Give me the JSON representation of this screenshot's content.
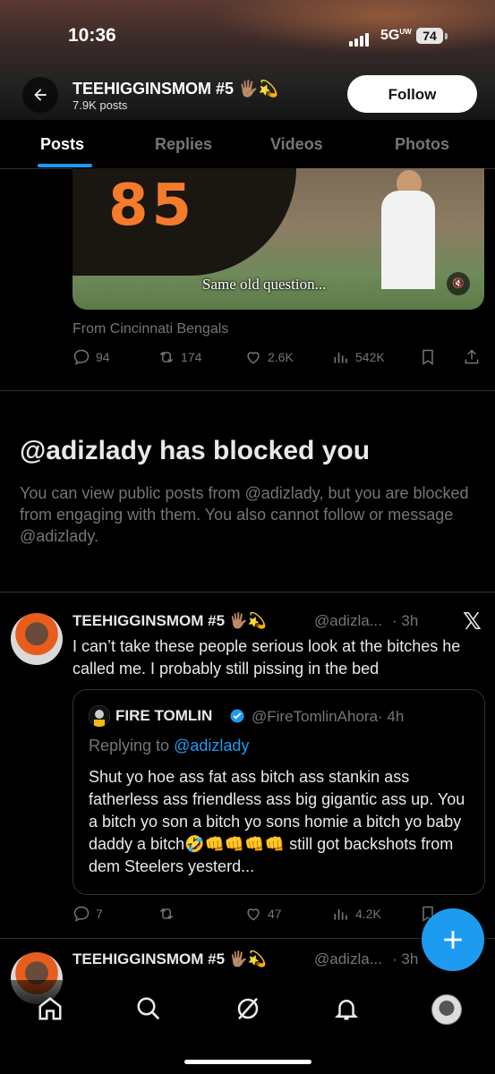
{
  "status_bar": {
    "time": "10:36",
    "network": "5G",
    "network_sub": "UW",
    "battery": "74"
  },
  "header": {
    "name": "TEEHIGGINSMOM #5 🖐🏽💫",
    "posts_count": "7.9K posts",
    "follow_label": "Follow"
  },
  "tabs": [
    {
      "label": "Posts",
      "active": true
    },
    {
      "label": "Replies",
      "active": false
    },
    {
      "label": "Videos",
      "active": false
    },
    {
      "label": "Photos",
      "active": false
    }
  ],
  "post1": {
    "video_caption": "Same old question...",
    "from": "From Cincinnati Bengals",
    "replies": "94",
    "reposts": "174",
    "likes": "2.6K",
    "views": "542K"
  },
  "blocked": {
    "title": "@adizlady has blocked you",
    "body": "You can view public posts from @adizlady, but you are blocked from engaging with them. You also cannot follow or message @adizlady."
  },
  "post2": {
    "name": "TEEHIGGINSMOM #5 🖐🏽💫",
    "handle": "@adizla...",
    "time": "· 3h",
    "text": "I can’t take these people serious look at the bitches he called me. I probably still pissing in the bed",
    "quote": {
      "name": "FIRE TOMLIN",
      "handle": "@FireTomlinAhora",
      "time": "· 4h",
      "replying_label": "Replying to ",
      "replying_handle": "@adizlady",
      "text": "Shut yo hoe ass fat ass bitch ass stankin ass fatherless ass friendless ass big gigantic ass up. You a bitch yo son a bitch yo sons homie a bitch yo baby daddy a bitch🤣👊👊👊👊 still got backshots from dem Steelers yesterd..."
    },
    "replies": "7",
    "likes": "47",
    "views": "4.2K"
  },
  "post3": {
    "name": "TEEHIGGINSMOM #5 🖐🏽💫",
    "handle": "@adizla...",
    "time": "· 3h"
  },
  "colors": {
    "accent": "#1d9bf0",
    "muted": "#71767b",
    "text": "#e7e9ea"
  }
}
